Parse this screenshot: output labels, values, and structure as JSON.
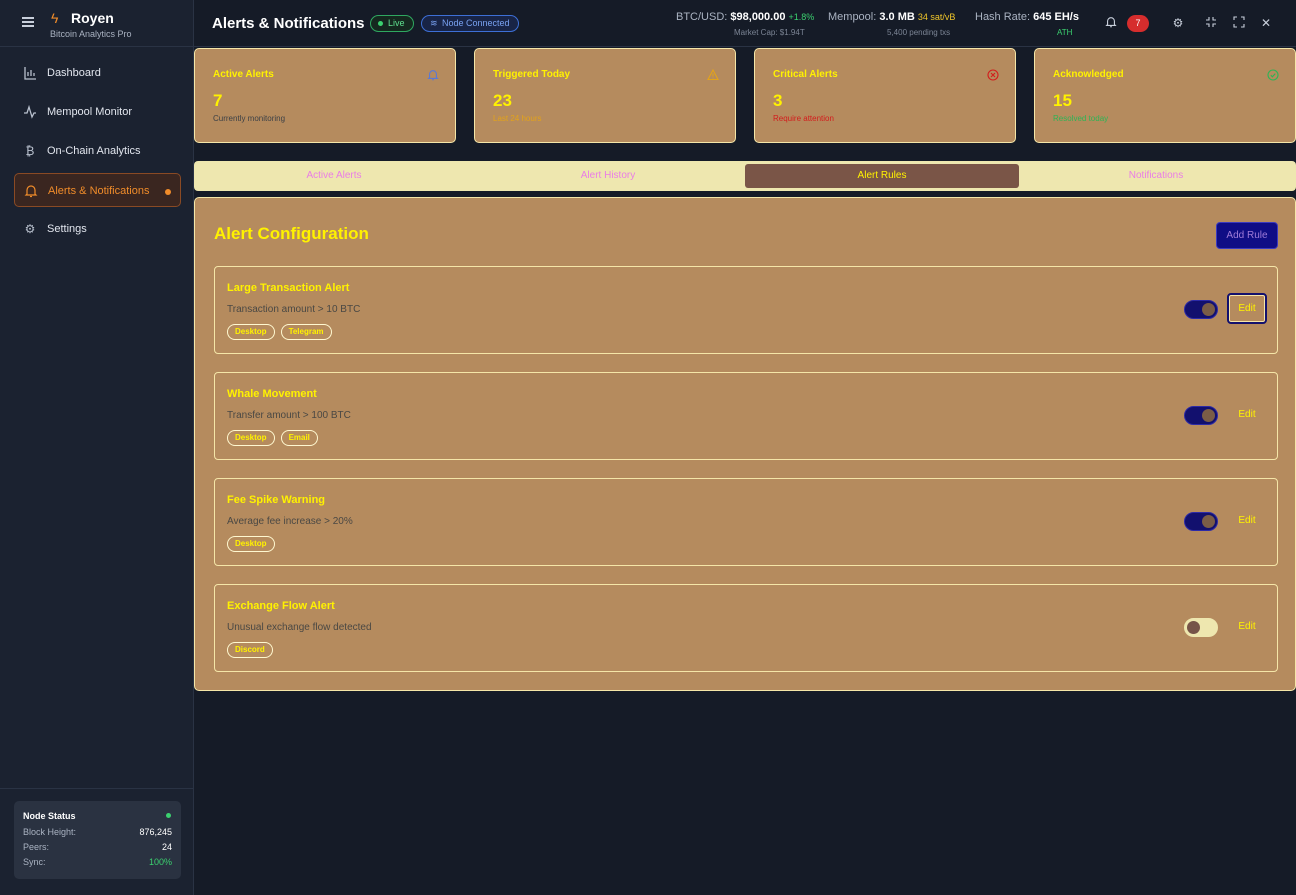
{
  "app": {
    "name": "Royen",
    "subtitle": "Bitcoin Analytics Pro"
  },
  "sidebar": {
    "items": [
      {
        "label": "Dashboard",
        "icon": "bar-chart-icon"
      },
      {
        "label": "Mempool Monitor",
        "icon": "activity-icon"
      },
      {
        "label": "On-Chain Analytics",
        "icon": "bitcoin-icon"
      },
      {
        "label": "Alerts & Notifications",
        "icon": "bell-icon",
        "active": true
      },
      {
        "label": "Settings",
        "icon": "gear-icon"
      }
    ],
    "node_status": {
      "title": "Node Status",
      "block_height_label": "Block Height:",
      "block_height": "876,245",
      "peers_label": "Peers:",
      "peers": "24",
      "sync_label": "Sync:",
      "sync": "100%"
    }
  },
  "header": {
    "title": "Alerts & Notifications",
    "live_label": "Live",
    "node_label": "Node Connected",
    "btc_label": "BTC/USD:",
    "btc_price": "$98,000.00",
    "btc_change": "+1.8%",
    "market_cap": "Market Cap: $1.94T",
    "mempool_label": "Mempool:",
    "mempool_size": "3.0 MB",
    "mempool_fee": "34 sat/vB",
    "mempool_pending": "5,400 pending txs",
    "hash_label": "Hash Rate:",
    "hash_rate": "645 EH/s",
    "hash_sub": "ATH",
    "notification_count": "7"
  },
  "cards": [
    {
      "title": "Active Alerts",
      "value": "7",
      "sub": "Currently monitoring",
      "icon": "bell-icon",
      "icon_color": "#5a78d6"
    },
    {
      "title": "Triggered Today",
      "value": "23",
      "sub": "Last 24 hours",
      "icon": "warning-icon",
      "icon_color": "#e3a31a"
    },
    {
      "title": "Critical Alerts",
      "value": "3",
      "sub": "Require attention",
      "icon": "x-circle-icon",
      "icon_color": "#d31c1c"
    },
    {
      "title": "Acknowledged",
      "value": "15",
      "sub": "Resolved today",
      "icon": "check-circle-icon",
      "icon_color": "#2eb455"
    }
  ],
  "tabs": [
    {
      "label": "Active Alerts"
    },
    {
      "label": "Alert History"
    },
    {
      "label": "Alert Rules",
      "active": true
    },
    {
      "label": "Notifications"
    }
  ],
  "panel": {
    "title": "Alert Configuration",
    "add_label": "Add Rule",
    "edit_label": "Edit",
    "rules": [
      {
        "name": "Large Transaction Alert",
        "desc": "Transaction amount > 10 BTC",
        "tags": [
          "Desktop",
          "Telegram"
        ],
        "enabled": true
      },
      {
        "name": "Whale Movement",
        "desc": "Transfer amount > 100 BTC",
        "tags": [
          "Desktop",
          "Email"
        ],
        "enabled": true
      },
      {
        "name": "Fee Spike Warning",
        "desc": "Average fee increase > 20%",
        "tags": [
          "Desktop"
        ],
        "enabled": true
      },
      {
        "name": "Exchange Flow Alert",
        "desc": "Unusual exchange flow detected",
        "tags": [
          "Discord"
        ],
        "enabled": false
      }
    ]
  }
}
